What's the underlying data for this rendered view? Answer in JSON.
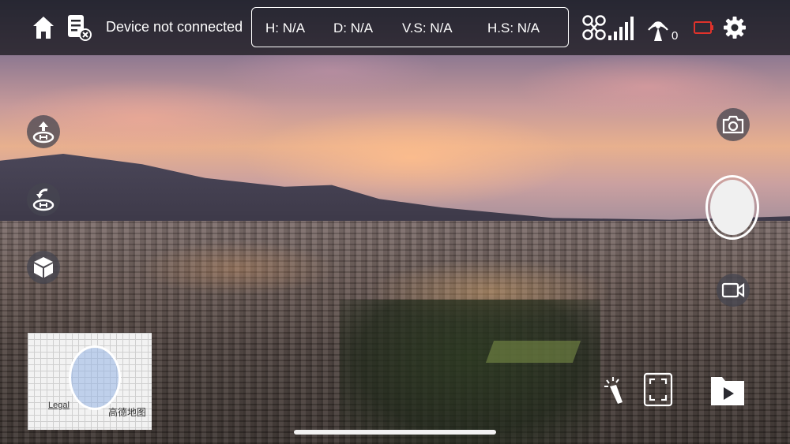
{
  "header": {
    "connection_status": "Device not connected",
    "telemetry": {
      "height": "H: N/A",
      "distance": "D: N/A",
      "vertical_speed": "V.S: N/A",
      "horizontal_speed": "H.S: N/A"
    },
    "rc_signal_count": "0",
    "icons": [
      "home-icon",
      "flight-log-icon",
      "drone-signal-icon",
      "remote-controller-signal-icon",
      "battery-icon",
      "settings-icon"
    ]
  },
  "left_controls": [
    "takeoff-icon",
    "return-home-icon",
    "3d-cube-icon"
  ],
  "right_controls": [
    "photo-mode-icon",
    "shutter-button",
    "video-mode-icon"
  ],
  "bottom_tools": [
    "flashlight-icon",
    "fullscreen-icon",
    "media-playback-icon"
  ],
  "minimap": {
    "legal": "Legal",
    "brand": "高德地图"
  },
  "colors": {
    "battery": "#e0322b",
    "bar_background": "#141418"
  }
}
